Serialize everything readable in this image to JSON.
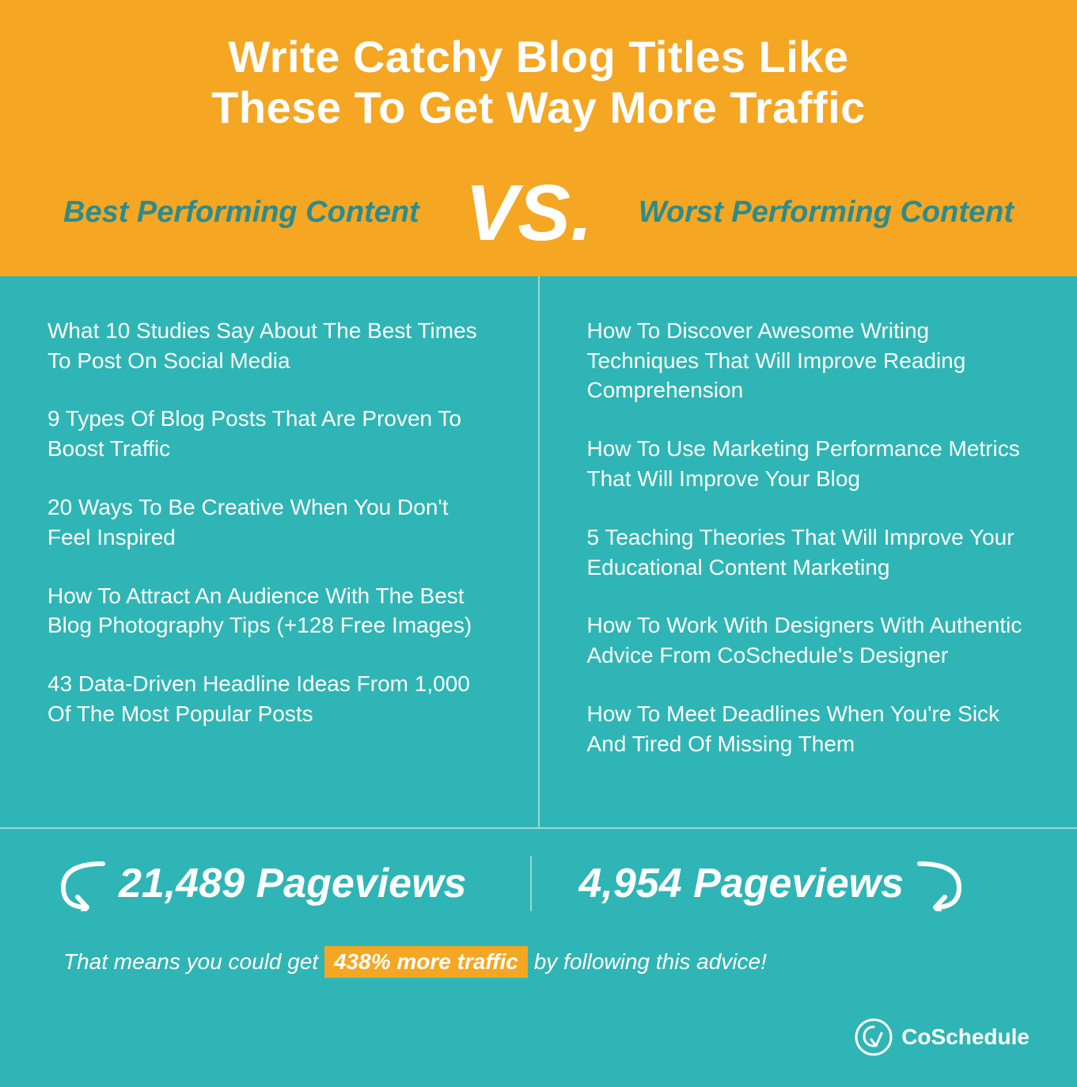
{
  "header": {
    "title_line1": "Write Catchy Blog Titles Like",
    "title_line2": "These To Get Way More Traffic"
  },
  "vs_section": {
    "best_label": "Best Performing Content",
    "vs_text": "VS.",
    "worst_label": "Worst Performing Content"
  },
  "best_performing": {
    "items": [
      "What 10 Studies Say About The Best Times To Post On Social Media",
      "9 Types Of Blog Posts That Are Proven To Boost Traffic",
      "20 Ways To Be Creative When You Don't Feel Inspired",
      "How To Attract An Audience With The Best Blog Photography Tips (+128 Free Images)",
      "43 Data-Driven Headline Ideas From 1,000 Of The Most Popular Posts"
    ],
    "pageviews": "21,489 Pageviews"
  },
  "worst_performing": {
    "items": [
      "How To Discover Awesome Writing Techniques That Will Improve Reading Comprehension",
      "How To Use Marketing Performance Metrics That Will Improve Your Blog",
      "5 Teaching Theories That Will Improve Your Educational Content Marketing",
      "How To Work With Designers With Authentic Advice From CoSchedule's Designer",
      "How To Meet Deadlines When You're Sick And Tired Of Missing Them"
    ],
    "pageviews": "4,954 Pageviews"
  },
  "footer": {
    "text_before": "That means you could get",
    "highlight": "438% more traffic",
    "text_after": "by following this advice!"
  },
  "logo": {
    "text": "CoSchedule"
  }
}
